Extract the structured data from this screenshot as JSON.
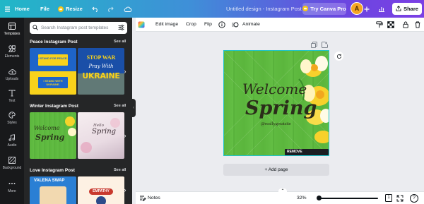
{
  "topbar": {
    "home_label": "Home",
    "file_label": "File",
    "resize_label": "Resize",
    "document_title": "Untitled design - Instagram Post",
    "try_pro_label": "Try Canva Pro",
    "avatar_initial": "A",
    "share_label": "Share",
    "crown_color": "#f5c518",
    "icons": [
      "menu-icon",
      "crown-icon",
      "undo-icon",
      "redo-icon",
      "cloud-icon",
      "plus-icon",
      "analytics-icon",
      "share-upload-icon"
    ]
  },
  "rail": {
    "items": [
      {
        "label": "Templates",
        "icon": "templates-icon"
      },
      {
        "label": "Elements",
        "icon": "elements-icon"
      },
      {
        "label": "Uploads",
        "icon": "uploads-icon"
      },
      {
        "label": "Text",
        "icon": "text-icon"
      },
      {
        "label": "Styles",
        "icon": "styles-icon"
      },
      {
        "label": "Audio",
        "icon": "audio-icon"
      },
      {
        "label": "Background",
        "icon": "background-icon"
      },
      {
        "label": "More",
        "icon": "more-icon"
      }
    ]
  },
  "panel": {
    "search_placeholder": "Search Instagram post templates",
    "sections": [
      {
        "title": "Peace Instagram Post",
        "see_all": "See all",
        "thumb1": {
          "top": "I STAND FOR PEACE.",
          "bottom": "I STAND WITH UKRAINE."
        },
        "thumb2": {
          "line1": "STOP WAR",
          "line2": "Pray With",
          "line3": "UKRAINE"
        }
      },
      {
        "title": "Winter Instagram Post",
        "see_all": "See all",
        "thumb1": {
          "line1": "Welcome",
          "line2": "Spring"
        },
        "thumb2": {
          "line1": "Hello",
          "line2": "Spring"
        }
      },
      {
        "title": "Love Instagram Post",
        "see_all": "See all",
        "thumb1": {
          "line1": "VALENA SWAP"
        },
        "thumb2": {
          "line1": "EMPATHY"
        }
      }
    ]
  },
  "toolbar": {
    "edit_image": "Edit image",
    "crop": "Crop",
    "flip": "Flip",
    "animate": "Animate"
  },
  "design": {
    "welcome": "Welcome",
    "spring": "Spring",
    "handle": "@reallygreatsite",
    "watermark_button": "REMOVE WATERMARKS",
    "brand_color": "#20c4cb"
  },
  "canvas": {
    "add_page": "+ Add page"
  },
  "bottombar": {
    "notes": "Notes",
    "zoom": "32%",
    "zoom_fraction": 0.02,
    "page_count": "1"
  }
}
